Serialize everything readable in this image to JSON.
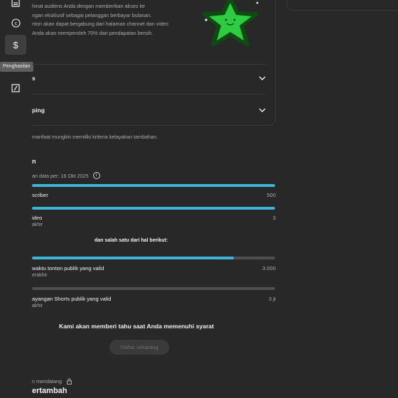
{
  "sidebar": {
    "tooltip": "Penghasilan",
    "items": [
      {
        "icon": "dashboard-icon"
      },
      {
        "icon": "copyright-icon"
      },
      {
        "icon": "dollar-icon",
        "active": true
      },
      {
        "icon": "customization-icon"
      }
    ]
  },
  "benefit_card": {
    "description_lines": [
      "hinat audiens Anda dengan memberikan akses ke",
      "ngan eksklusif sebagai pelanggan berbayar bulanan.",
      "nton akan dapat bergabung dari halaman channel dan video",
      "Anda akan memperoleh 70% dari pendapatan bersih."
    ],
    "rows": [
      {
        "label": "s"
      },
      {
        "label": "ping"
      }
    ]
  },
  "eligibility_note": "manfaat mungkin memiliki kriteria kelayakan tambahan.",
  "requirements": {
    "section_initial": "n",
    "data_as_of": "an data per: 16 Okt 2025",
    "subscribers": {
      "label": "scriber",
      "value": "500",
      "progress": 1.0
    },
    "videos": {
      "label": "ideo",
      "sub": "akhir",
      "value": "3",
      "progress": 1.0
    },
    "and_one_of": "dan salah satu dari hal berikut:",
    "watch_hours": {
      "label": "waktu tonton publik yang valid",
      "sub": "erakhir",
      "value": "3.000",
      "progress": 0.83
    },
    "shorts_views": {
      "label": "ayangan Shorts publik yang valid",
      "sub": "akhir",
      "value": "3 jt",
      "progress": 0.0
    }
  },
  "notify_text": "Kami akan memberi tahu saat Anda memenuhi syarat",
  "apply_button": "Daftar sekarang",
  "upcoming": {
    "label": "n mendatang",
    "title": "ertambah"
  },
  "colors": {
    "background": "#282828",
    "progress": "#3fb4d9",
    "star": "#2ecc40"
  }
}
